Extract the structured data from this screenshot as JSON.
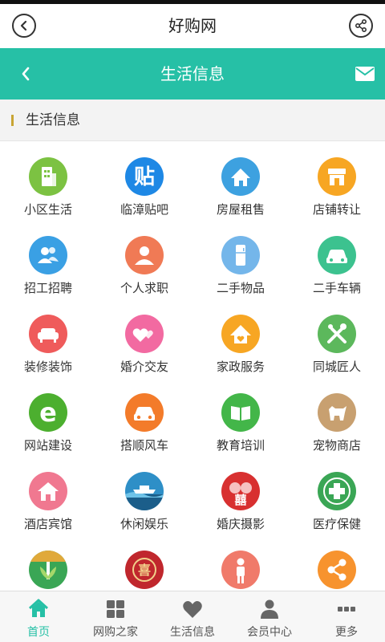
{
  "header": {
    "title": "好购网"
  },
  "subheader": {
    "title": "生活信息"
  },
  "section": {
    "title": "生活信息"
  },
  "categories": [
    {
      "label": "小区生活",
      "icon": "building-icon",
      "color": "#7cc242"
    },
    {
      "label": "临漳贴吧",
      "icon": "tie-character-icon",
      "color": "#1e88e5"
    },
    {
      "label": "房屋租售",
      "icon": "house-icon",
      "color": "#3da1e0"
    },
    {
      "label": "店铺转让",
      "icon": "shop-icon",
      "color": "#f7a623"
    },
    {
      "label": "招工招聘",
      "icon": "people-icon",
      "color": "#3aa0e4"
    },
    {
      "label": "个人求职",
      "icon": "person-icon",
      "color": "#f07a55"
    },
    {
      "label": "二手物品",
      "icon": "fridge-icon",
      "color": "#74b6ea"
    },
    {
      "label": "二手车辆",
      "icon": "car-icon",
      "color": "#3cc28f"
    },
    {
      "label": "装修装饰",
      "icon": "sofa-icon",
      "color": "#ef5b5b"
    },
    {
      "label": "婚介交友",
      "icon": "hearts-icon",
      "color": "#f26aa1"
    },
    {
      "label": "家政服务",
      "icon": "home-service-icon",
      "color": "#f7a623"
    },
    {
      "label": "同城匠人",
      "icon": "tools-icon",
      "color": "#5cb85c"
    },
    {
      "label": "网站建设",
      "icon": "e-logo-icon",
      "color": "#4caf2f"
    },
    {
      "label": "搭顺风车",
      "icon": "carpool-icon",
      "color": "#f37b2a"
    },
    {
      "label": "教育培训",
      "icon": "book-icon",
      "color": "#43b649"
    },
    {
      "label": "宠物商店",
      "icon": "dog-icon",
      "color": "#c8a070"
    },
    {
      "label": "酒店宾馆",
      "icon": "hotel-icon",
      "color": "#f07890"
    },
    {
      "label": "休闲娱乐",
      "icon": "leisure-icon",
      "color": "#2e8fc7"
    },
    {
      "label": "婚庆摄影",
      "icon": "wedding-icon",
      "color": "#d83030"
    },
    {
      "label": "医疗保健",
      "icon": "medical-cross-icon",
      "color": "#3aa655"
    },
    {
      "label": "",
      "icon": "wheat-icon",
      "color": "#3aa655"
    },
    {
      "label": "",
      "icon": "emblem-icon",
      "color": "#c0272d"
    },
    {
      "label": "",
      "icon": "standing-person-icon",
      "color": "#f07a6a"
    },
    {
      "label": "",
      "icon": "share-icon",
      "color": "#f7932e"
    }
  ],
  "tabs": [
    {
      "label": "首页",
      "icon": "home-icon",
      "active": true
    },
    {
      "label": "网购之家",
      "icon": "grid-icon",
      "active": false
    },
    {
      "label": "生活信息",
      "icon": "heart-icon",
      "active": false
    },
    {
      "label": "会员中心",
      "icon": "user-icon",
      "active": false
    },
    {
      "label": "更多",
      "icon": "more-icon",
      "active": false
    }
  ],
  "colors": {
    "teal": "#26c0a6",
    "accent_bar": "#c8a534",
    "tab_gray": "#666666"
  }
}
